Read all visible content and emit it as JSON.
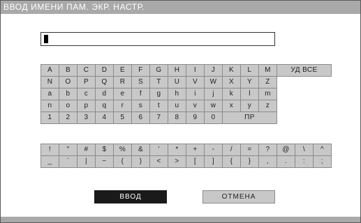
{
  "title": "ВВОД ИМЕНИ ПАМ. ЭКР. НАСТР.",
  "name_value": "",
  "keyboard": {
    "rows": [
      [
        "A",
        "B",
        "C",
        "D",
        "E",
        "F",
        "G",
        "H",
        "I",
        "J",
        "K",
        "L",
        "M"
      ],
      [
        "N",
        "O",
        "P",
        "Q",
        "R",
        "S",
        "T",
        "U",
        "V",
        "W",
        "X",
        "Y",
        "Z"
      ],
      [
        "a",
        "b",
        "c",
        "d",
        "e",
        "f",
        "g",
        "h",
        "i",
        "j",
        "k",
        "l",
        "m"
      ],
      [
        "n",
        "o",
        "p",
        "q",
        "r",
        "s",
        "t",
        "u",
        "v",
        "w",
        "x",
        "y",
        "z"
      ],
      [
        "1",
        "2",
        "3",
        "4",
        "5",
        "6",
        "7",
        "8",
        "9",
        "0"
      ]
    ],
    "delete_all": "УД ВСЕ",
    "space": "ПР"
  },
  "symbols": {
    "rows": [
      [
        "!",
        "\"",
        "#",
        "$",
        "%",
        "&",
        "'",
        "*",
        "+",
        "-",
        "/",
        "=",
        "?",
        "@",
        "\\",
        "^"
      ],
      [
        "_",
        "`",
        "|",
        "~",
        "(",
        ")",
        "<",
        ">",
        "[",
        "]",
        "{",
        "}",
        ",",
        ".",
        ":",
        ";"
      ]
    ]
  },
  "buttons": {
    "enter": "ВВОД",
    "cancel": "ОТМЕНА"
  }
}
